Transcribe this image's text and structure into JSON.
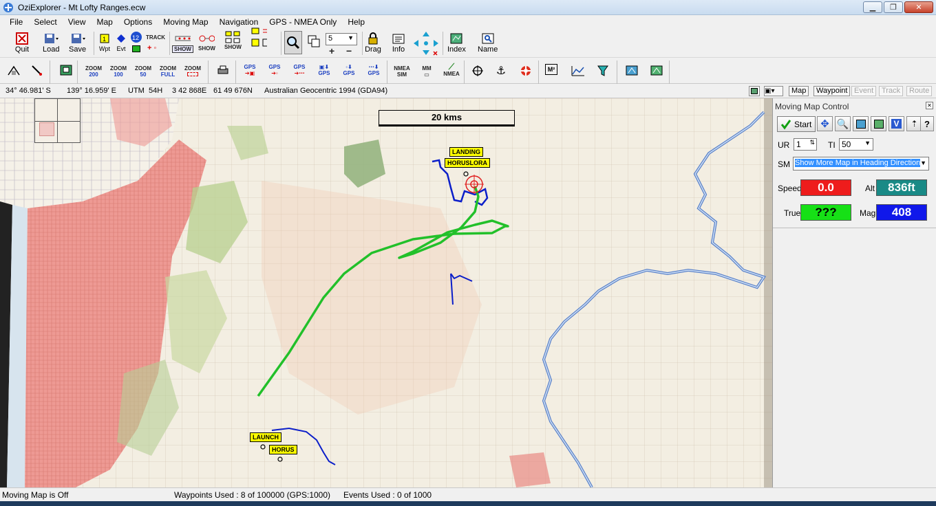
{
  "window": {
    "title": "OziExplorer - Mt Lofty Ranges.ecw"
  },
  "menu": [
    "File",
    "Select",
    "View",
    "Map",
    "Options",
    "Moving Map",
    "Navigation",
    "GPS - NMEA Only",
    "Help"
  ],
  "toolbar1": {
    "quit": "Quit",
    "load": "Load",
    "save": "Save",
    "wpt": "Wpt",
    "evt": "Evt",
    "track": "TRACK",
    "show": "SHOW",
    "zoom_value": "5",
    "drag": "Drag",
    "info": "Info",
    "index": "Index",
    "name": "Name"
  },
  "toolbar2": {
    "zoom200": [
      "ZOOM",
      "200"
    ],
    "zoom100": [
      "ZOOM",
      "100"
    ],
    "zoom50": [
      "ZOOM",
      "50"
    ],
    "zoomfull": [
      "ZOOM",
      "FULL"
    ],
    "zoom": "ZOOM",
    "gps": "GPS",
    "nmea_sim": [
      "NMEA",
      "SIM"
    ],
    "mm": "MM",
    "nmea": "NMEA",
    "m2": "M²"
  },
  "coords": {
    "lat": "34° 46.981' S",
    "lon": "139° 16.959' E",
    "utm_label": "UTM",
    "zone": "54H",
    "easting": "3 42 868E",
    "northing": "61 49 676N",
    "datum": "Australian Geocentric 1994 (GDA94)",
    "buttons": [
      "Map",
      "Waypoint",
      "Event",
      "Track",
      "Route"
    ]
  },
  "map": {
    "scale": "20 kms",
    "waypoints": {
      "landing": "LANDING",
      "horuslora": "HORUSLORA",
      "launch": "LAUNCH",
      "horus": "HORUS"
    },
    "colors": {
      "track": "#22c02a",
      "route": "#0b1ec9",
      "target": "#e02020",
      "river": "#5b82c9"
    }
  },
  "moving_map": {
    "title": "Moving Map Control",
    "start": "Start",
    "ur_label": "UR",
    "ur_value": "1",
    "ti_label": "TI",
    "ti_value": "50",
    "sm_label": "SM",
    "sm_value": "Show More Map in Heading Direction",
    "speed_label": "Speed",
    "speed_value": "0.0",
    "speed_color": "#ee1c1c",
    "alt_label": "Alt",
    "alt_value": "836ft",
    "alt_color": "#1a8a86",
    "true_label": "True",
    "true_value": "???",
    "true_color": "#16e016",
    "mag_label": "Mag",
    "mag_value": "408",
    "mag_color": "#1018ea"
  },
  "status": {
    "moving_map": "Moving Map is Off",
    "waypoints": "Waypoints Used : 8 of 100000  (GPS:1000)",
    "events": "Events Used : 0 of 1000"
  }
}
